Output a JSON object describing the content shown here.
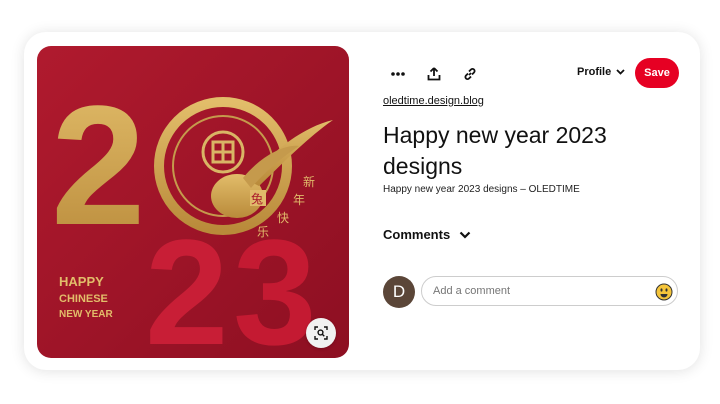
{
  "pin": {
    "image": {
      "alt_icon": "chinese-new-year-2023-artwork",
      "year_digits": [
        "2",
        "0",
        "2",
        "3"
      ],
      "caption_lines": [
        "HAPPY",
        "CHINESE",
        "NEW YEAR"
      ],
      "glyphs": [
        "兔",
        "新",
        "年",
        "快",
        "乐"
      ],
      "colors": {
        "background": "#a8162a",
        "gold": "#d2a64f",
        "red_digit": "#c81e36"
      }
    },
    "lens_icon": "visual-search-icon",
    "toolbar": {
      "more_icon": "more-icon",
      "share_icon": "share-icon",
      "link_icon": "link-icon",
      "profile_label": "Profile",
      "save_label": "Save"
    },
    "source": "oledtime.design.blog",
    "title": "Happy new year 2023 designs",
    "description": "Happy new year 2023 designs – OLEDTIME",
    "comments": {
      "label": "Comments",
      "avatar_initial": "D",
      "placeholder": "Add a comment",
      "emoji_icon": "emoji-icon"
    }
  },
  "colors": {
    "save": "#e60023",
    "avatar": "#5b4638"
  }
}
